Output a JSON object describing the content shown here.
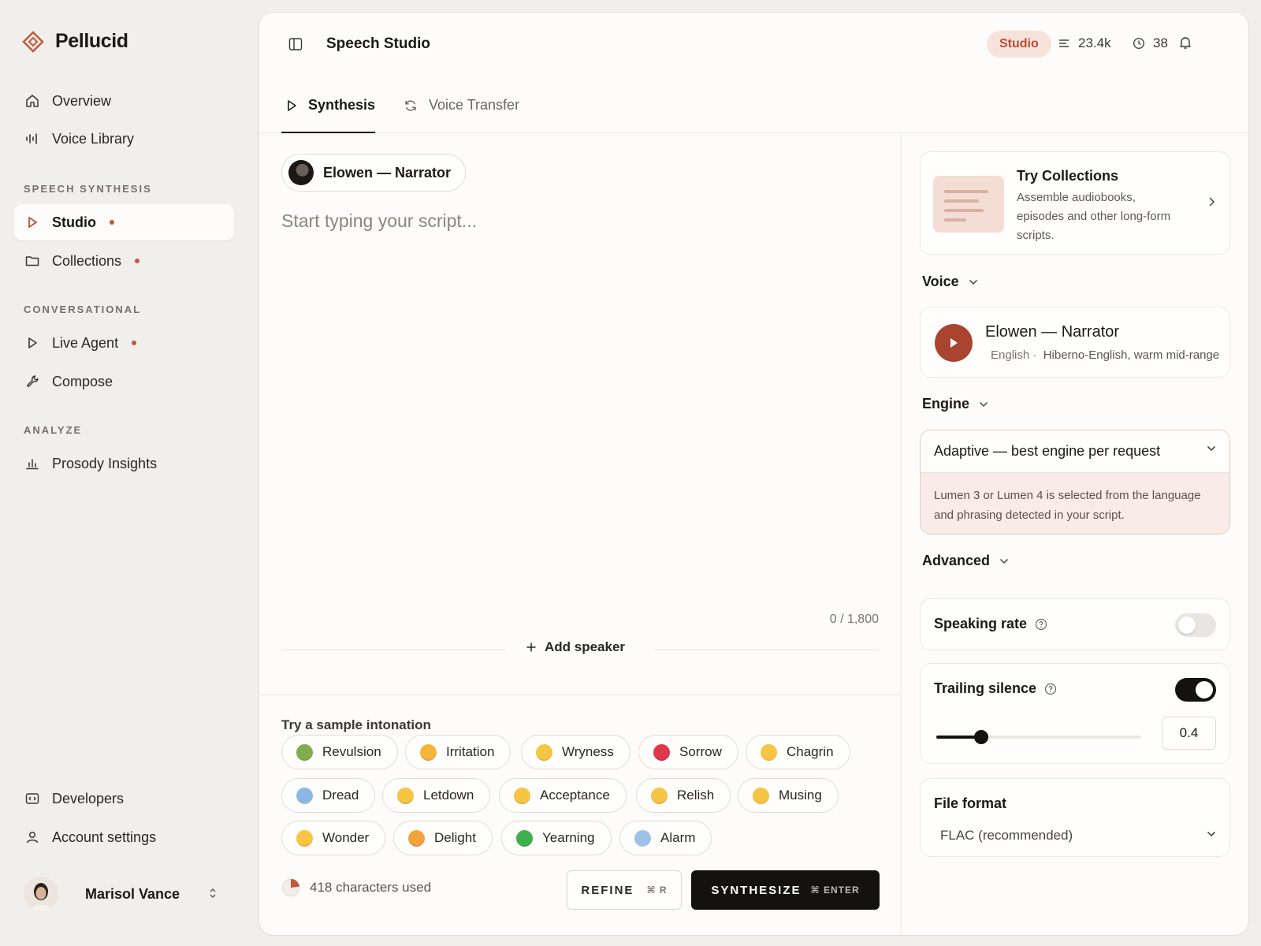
{
  "app": {
    "name": "Pellucid",
    "brand_color": "#c2573a"
  },
  "sidebar": {
    "top_items": [
      {
        "label": "Overview",
        "icon": "home-icon"
      },
      {
        "label": "Voice Library",
        "icon": "waveform-icon"
      }
    ],
    "sections": [
      {
        "title": "SPEECH SYNTHESIS",
        "items": [
          {
            "label": "Studio",
            "icon": "play-icon",
            "active": true,
            "dot": true
          },
          {
            "label": "Collections",
            "icon": "folder-icon",
            "dot": true
          }
        ]
      },
      {
        "title": "CONVERSATIONAL",
        "items": [
          {
            "label": "Live Agent",
            "icon": "play-icon",
            "dot": true
          },
          {
            "label": "Compose",
            "icon": "wrench-icon"
          }
        ]
      },
      {
        "title": "ANALYZE",
        "items": [
          {
            "label": "Prosody Insights",
            "icon": "bar-chart-icon"
          }
        ]
      }
    ],
    "bottom_items": [
      {
        "label": "Developers",
        "icon": "code-icon"
      },
      {
        "label": "Account settings",
        "icon": "user-icon"
      }
    ],
    "user": {
      "name": "Marisol Vance"
    }
  },
  "header": {
    "title": "Speech Studio",
    "plan_badge": "Studio",
    "credits": "23.4k",
    "minutes": "38"
  },
  "tabs": [
    {
      "label": "Synthesis",
      "active": true
    },
    {
      "label": "Voice Transfer",
      "active": false
    }
  ],
  "editor": {
    "speaker": "Elowen — Narrator",
    "placeholder": "Start typing your script...",
    "char_count": "0 / 1,800",
    "add_speaker": "Add speaker",
    "sample_label": "Try a sample intonation",
    "intonations": [
      {
        "label": "Revulsion",
        "emoji": "nauseated-face"
      },
      {
        "label": "Irritation",
        "emoji": "angry-face"
      },
      {
        "label": "Wryness",
        "emoji": "eye-roll-face"
      },
      {
        "label": "Sorrow",
        "emoji": "broken-heart"
      },
      {
        "label": "Chagrin",
        "emoji": "flushed-face"
      },
      {
        "label": "Dread",
        "emoji": "fearful-face"
      },
      {
        "label": "Letdown",
        "emoji": "disappointed-face"
      },
      {
        "label": "Acceptance",
        "emoji": "pensive-face"
      },
      {
        "label": "Relish",
        "emoji": "yum-face"
      },
      {
        "label": "Musing",
        "emoji": "thinking-face"
      },
      {
        "label": "Wonder",
        "emoji": "star-struck-face"
      },
      {
        "label": "Delight",
        "emoji": "party-popper"
      },
      {
        "label": "Yearning",
        "emoji": "green-heart"
      },
      {
        "label": "Alarm",
        "emoji": "screaming-face"
      }
    ],
    "usage": "418 characters used",
    "usage_fraction": 0.23,
    "refine_label": "REFINE",
    "refine_shortcut": "⌘ R",
    "synthesize_label": "SYNTHESIZE",
    "synthesize_shortcut": "⌘ ENTER"
  },
  "settings": {
    "collections": {
      "title": "Try Collections",
      "description": "Assemble audiobooks, episodes and other long-form scripts."
    },
    "voice": {
      "label": "Voice",
      "name": "Elowen — Narrator",
      "language": "English ·",
      "description": "Hiberno-English, warm mid-range"
    },
    "engine": {
      "label": "Engine",
      "selected": "Adaptive — best engine per request",
      "note": "Lumen 3 or Lumen 4 is selected from the language and phrasing detected in your script."
    },
    "advanced": {
      "label": "Advanced",
      "speaking_rate": {
        "label": "Speaking rate",
        "enabled": false
      },
      "trailing_silence": {
        "label": "Trailing silence",
        "enabled": true,
        "value": "0.4",
        "slider_fraction": 0.22
      }
    },
    "file_format": {
      "label": "File format",
      "selected": "FLAC (recommended)"
    }
  }
}
